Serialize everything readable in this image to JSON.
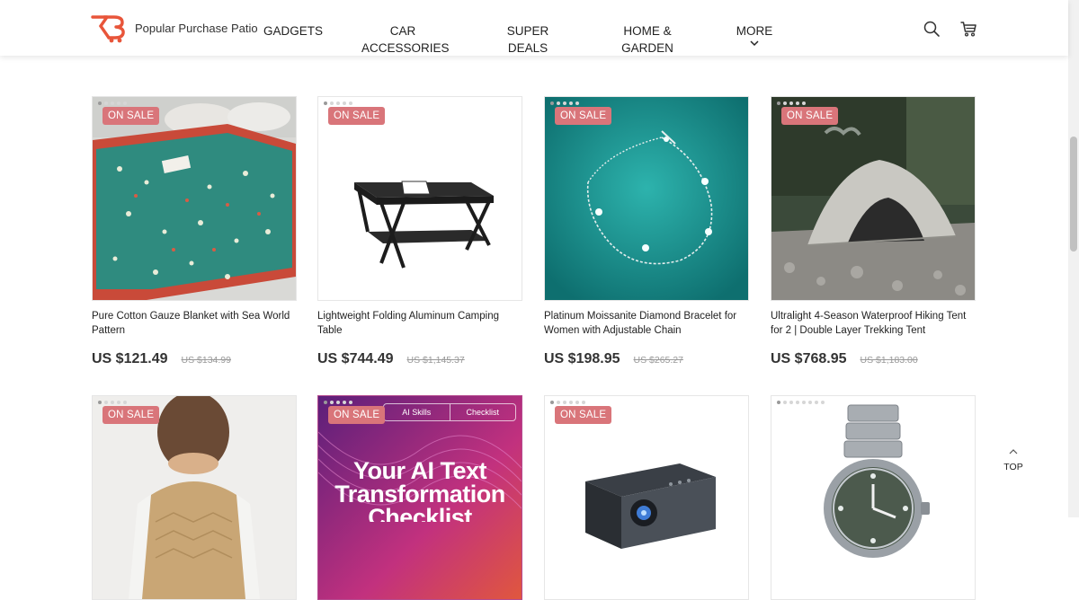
{
  "header": {
    "brand": "Popular Purchase Patio",
    "nav": [
      {
        "line1": "GADGETS",
        "line2": ""
      },
      {
        "line1": "CAR",
        "line2": "ACCESSORIES"
      },
      {
        "line1": "SUPER",
        "line2": "DEALS"
      },
      {
        "line1": "HOME &",
        "line2": "GARDEN"
      },
      {
        "line1": "MORE",
        "line2": ""
      }
    ],
    "icons": [
      "search-icon",
      "cart-icon"
    ]
  },
  "colors": {
    "badge": "#d9757a",
    "logo": "#e8553a"
  },
  "products": [
    {
      "badge": "ON SALE",
      "title": "Pure Cotton Gauze Blanket with Sea World Pattern",
      "price": "US $121.49",
      "old_price": "US $134.99"
    },
    {
      "badge": "ON SALE",
      "title": "Lightweight Folding Aluminum Camping Table",
      "price": "US $744.49",
      "old_price": "US $1,145.37"
    },
    {
      "badge": "ON SALE",
      "title": "Platinum Moissanite Diamond Bracelet for Women with Adjustable Chain",
      "price": "US $198.95",
      "old_price": "US $265.27"
    },
    {
      "badge": "ON SALE",
      "title": "Ultralight 4-Season Waterproof Hiking Tent for 2 | Double Layer Trekking Tent",
      "price": "US $768.95",
      "old_price": "US $1,183.00"
    },
    {
      "badge": "ON SALE"
    },
    {
      "badge": "ON SALE",
      "overlay": {
        "tab1": "AI Skills",
        "tab2": "Checklist",
        "headline": "Your AI Text Transformation Checklist"
      }
    },
    {
      "badge": "ON SALE"
    },
    {}
  ],
  "back_to_top": "TOP"
}
